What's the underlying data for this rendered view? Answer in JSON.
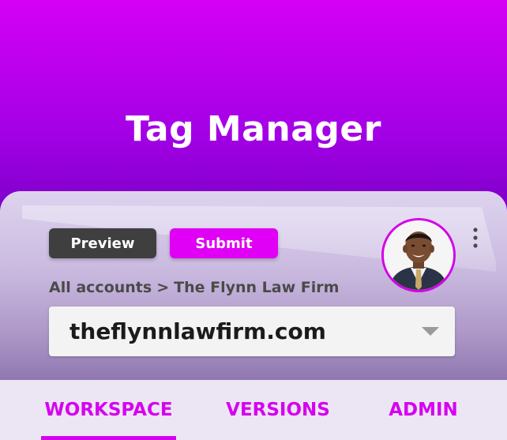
{
  "app": {
    "title": "Tag Manager"
  },
  "toolbar": {
    "preview_label": "Preview",
    "submit_label": "Submit"
  },
  "breadcrumb": {
    "root": "All accounts",
    "separator": ">",
    "current": "The Flynn Law Firm"
  },
  "container_select": {
    "value": "theflynnlawfirm.com"
  },
  "tabs": [
    {
      "label": "WORKSPACE",
      "active": true
    },
    {
      "label": "VERSIONS",
      "active": false
    },
    {
      "label": "ADMIN",
      "active": false
    }
  ],
  "icons": {
    "avatar": "user-avatar",
    "more": "more-vert-icon",
    "dropdown": "chevron-down-icon"
  },
  "colors": {
    "accent": "#e000f5",
    "preview_button": "#3f3f3f",
    "header_top": "#d400f5",
    "header_bottom": "#5a0099"
  }
}
